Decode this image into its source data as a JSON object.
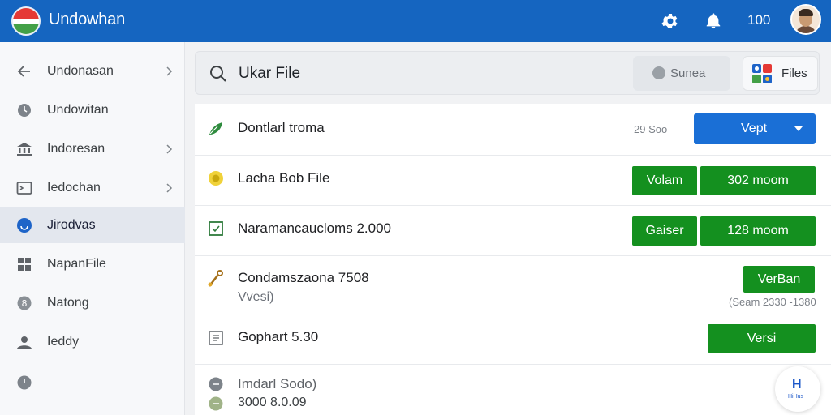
{
  "header": {
    "app_title": "Undowhan",
    "count": "100",
    "icons": [
      "gear-icon",
      "bell-icon"
    ],
    "accent": "#1565c0"
  },
  "sidebar": {
    "items": [
      {
        "label": "Undonasan",
        "icon": "arrow-left-icon",
        "chevron": true
      },
      {
        "label": "Undowitan",
        "icon": "clock-icon",
        "chevron": false
      },
      {
        "label": "Indoresan",
        "icon": "bank-icon",
        "chevron": true
      },
      {
        "label": "Iedochan",
        "icon": "terminal-icon",
        "chevron": true
      },
      {
        "label": "Jirodvas",
        "icon": "circle-badge-icon",
        "chevron": false,
        "active": true
      },
      {
        "label": "NapanFile",
        "icon": "grid-icon",
        "chevron": false
      },
      {
        "label": "Natong",
        "icon": "info-circle-icon",
        "chevron": false
      },
      {
        "label": "Ieddy",
        "icon": "person-icon",
        "chevron": false
      },
      {
        "label": "",
        "icon": "power-icon",
        "chevron": false
      }
    ]
  },
  "search": {
    "value": "Ukar File",
    "chip_label": "Sunea",
    "files_label": "Files"
  },
  "files": [
    {
      "title": "Dontlarl troma",
      "meta": "29 Soo",
      "action": "Vept",
      "icon": "leaf-icon"
    },
    {
      "title": "Lacha Bob File",
      "tag": "Volam",
      "action": "302 moom",
      "icon": "coin-icon"
    },
    {
      "title": "Naramancaucloms 2.000",
      "tag": "Gaiser",
      "action": "128 moom",
      "icon": "check-square-icon"
    },
    {
      "title": "Condamszaona 7508",
      "subtitle": "Vvesi)",
      "meta": "(Seam 2330 -1380",
      "action": "VerBan",
      "icon": "tool-icon"
    },
    {
      "title": "Gophart 5.30",
      "action": "Versi",
      "icon": "document-icon"
    },
    {
      "title": "Imdarl Sodo)",
      "subtitle": "3000 8.0.09",
      "icon": "circle-icon"
    }
  ],
  "fab": {
    "glyph": "H",
    "caption": "HiHus"
  },
  "colors": {
    "blue_button": "#1a6fd6",
    "green_button": "#14901f"
  }
}
